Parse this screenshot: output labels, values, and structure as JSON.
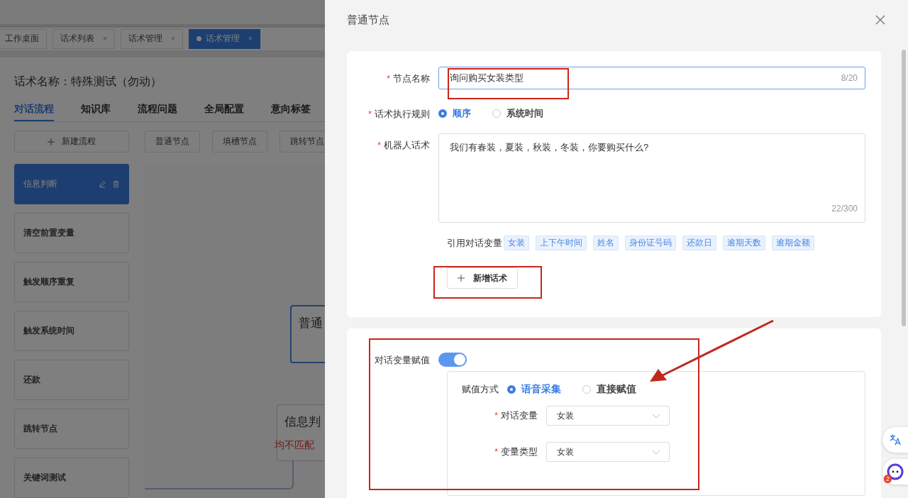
{
  "header_tabs": [
    {
      "label": "工作桌面",
      "selected": false
    },
    {
      "label": "话术列表",
      "close": "×",
      "selected": false
    },
    {
      "label": "话术管理",
      "close": "×",
      "selected": false
    },
    {
      "label": "话术管理",
      "close": "×",
      "selected": true
    }
  ],
  "script_title": "话术名称：特殊测试（勿动）",
  "section_tabs": [
    {
      "label": "对话流程",
      "selected": true
    },
    {
      "label": "知识库",
      "selected": false
    },
    {
      "label": "流程问题",
      "selected": false
    },
    {
      "label": "全局配置",
      "selected": false
    },
    {
      "label": "意向标签",
      "selected": false
    }
  ],
  "new_flow_button": "新建流程",
  "node_type_buttons": [
    "普通节点",
    "填槽节点",
    "跳转节点"
  ],
  "flows": [
    {
      "name": "信息判断",
      "selected": true
    },
    {
      "name": "清空前置变量",
      "selected": false
    },
    {
      "name": "触发顺序重复",
      "selected": false
    },
    {
      "name": "触发系统时间",
      "selected": false
    },
    {
      "name": "还款",
      "selected": false
    },
    {
      "name": "跳转节点",
      "selected": false
    },
    {
      "name": "关键词测试",
      "selected": false
    }
  ],
  "canvas_nodes": [
    {
      "kind": "normal",
      "title": "普通"
    },
    {
      "kind": "judge",
      "title": "信息判",
      "branch_label": "均不匹配"
    }
  ],
  "drawer": {
    "title": "普通节点",
    "node_name": {
      "required_mark": "*",
      "label": "节点名称",
      "value": "询问购买女装类型",
      "count": "8/20"
    },
    "rule": {
      "required_mark": "*",
      "label": "话术执行规则",
      "options": [
        {
          "label": "顺序",
          "selected": true
        },
        {
          "label": "系统时间",
          "selected": false
        }
      ]
    },
    "robot_speech": {
      "required_mark": "*",
      "label": "机器人话术",
      "value": "我们有春装，夏装，秋装，冬装，你要购买什么?",
      "count": "22/300"
    },
    "variables": {
      "label": "引用对话变量",
      "tags": [
        "女装",
        "上下午时间",
        "姓名",
        "身份证号码",
        "还款日",
        "逾期天数",
        "逾期金额"
      ]
    },
    "add_speech_button": "新增话术",
    "assignment": {
      "label": "对话变量赋值",
      "on": true,
      "method": {
        "label": "赋值方式",
        "options": [
          {
            "label": "语音采集",
            "selected": true
          },
          {
            "label": "直接赋值",
            "selected": false
          }
        ]
      },
      "fields": [
        {
          "required_mark": "*",
          "label": "对话变量",
          "value": "女装"
        },
        {
          "required_mark": "*",
          "label": "变量类型",
          "value": "女装"
        }
      ]
    }
  },
  "chat_badge": "2"
}
